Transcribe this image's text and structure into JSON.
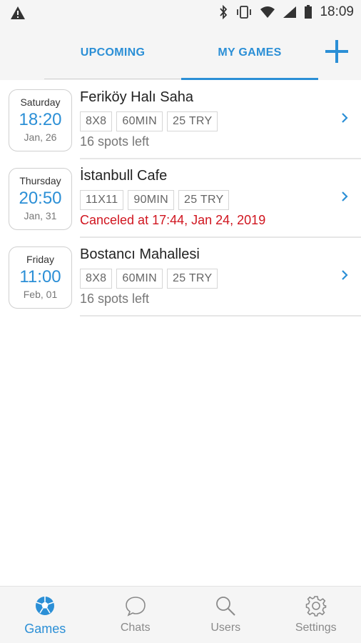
{
  "status_bar": {
    "time": "18:09"
  },
  "header": {
    "tabs": [
      {
        "label": "UPCOMING",
        "active": false
      },
      {
        "label": "MY GAMES",
        "active": true
      }
    ]
  },
  "games": [
    {
      "day": "Saturday",
      "time": "18:20",
      "date": "Jan, 26",
      "name": "Feriköy Halı Saha",
      "format": "8X8",
      "duration": "60MIN",
      "price": "25 TRY",
      "status": "16 spots left",
      "canceled": false
    },
    {
      "day": "Thursday",
      "time": "20:50",
      "date": "Jan, 31",
      "name": "İstanbull Cafe",
      "format": "11X11",
      "duration": "90MIN",
      "price": "25 TRY",
      "status": "Canceled at 17:44, Jan 24, 2019",
      "canceled": true
    },
    {
      "day": "Friday",
      "time": "11:00",
      "date": "Feb, 01",
      "name": "Bostancı Mahallesi",
      "format": "8X8",
      "duration": "60MIN",
      "price": "25 TRY",
      "status": "16 spots left",
      "canceled": false
    }
  ],
  "bottom_nav": [
    {
      "label": "Games",
      "icon": "soccer-ball-icon",
      "active": true
    },
    {
      "label": "Chats",
      "icon": "chat-bubble-icon",
      "active": false
    },
    {
      "label": "Users",
      "icon": "search-icon",
      "active": false
    },
    {
      "label": "Settings",
      "icon": "gear-icon",
      "active": false
    }
  ],
  "colors": {
    "accent": "#2b8fd6",
    "canceled": "#d0151f"
  }
}
